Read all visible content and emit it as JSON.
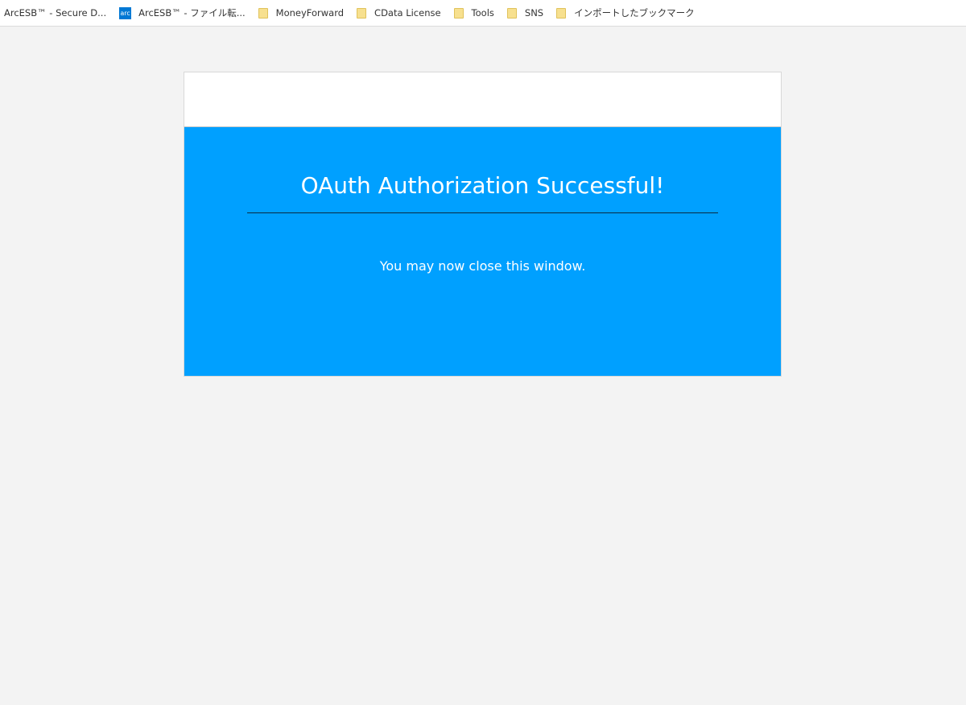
{
  "bookmarks": [
    {
      "label": "ArcESB™ - Secure D...",
      "icon": "none"
    },
    {
      "label": "ArcESB™ - ファイル転...",
      "icon": "arc-icon",
      "icon_text": "arc"
    },
    {
      "label": "MoneyForward",
      "icon": "folder-icon"
    },
    {
      "label": "CData License",
      "icon": "folder-icon"
    },
    {
      "label": "Tools",
      "icon": "folder-icon"
    },
    {
      "label": "SNS",
      "icon": "folder-icon"
    },
    {
      "label": "インポートしたブックマーク",
      "icon": "folder-icon"
    }
  ],
  "main": {
    "title": "OAuth Authorization Successful!",
    "message": "You may now close this window."
  },
  "colors": {
    "accent": "#00a0ff",
    "page_background": "#f3f3f3",
    "folder": "#f7e08f"
  }
}
